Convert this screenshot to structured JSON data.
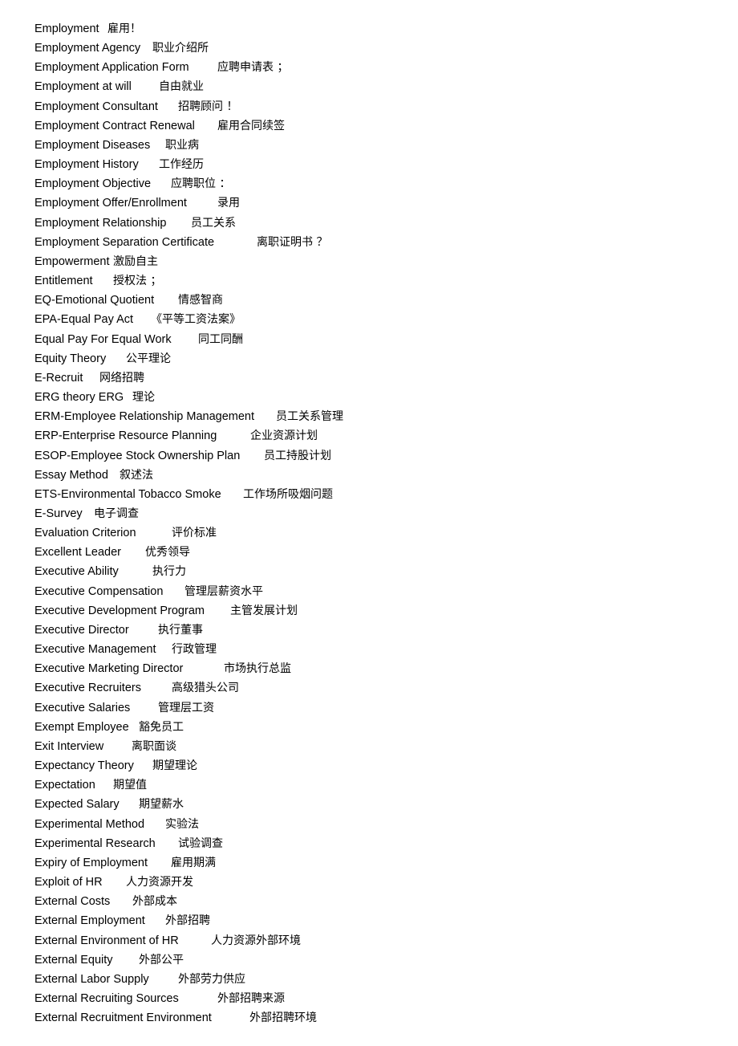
{
  "glossary": {
    "entries": [
      {
        "term": "Employment",
        "translation": "雇用！"
      },
      {
        "term": "Employment Agency",
        "translation": "职业介绍所"
      },
      {
        "term": "Employment Application Form",
        "translation": "应聘申请表 ；"
      },
      {
        "term": "Employment at will",
        "translation": "自由就业"
      },
      {
        "term": "Employment Consultant",
        "translation": "招聘顾问 ！"
      },
      {
        "term": "Employment Contract Renewal",
        "translation": "雇用合同续签"
      },
      {
        "term": "Employment Diseases",
        "translation": "职业病"
      },
      {
        "term": "Employment History",
        "translation": "工作经历"
      },
      {
        "term": "Employment Objective",
        "translation": "应聘职位 ："
      },
      {
        "term": "Employment Offer/Enrollment",
        "translation": "录用"
      },
      {
        "term": "Employment Relationship",
        "translation": "员工关系"
      },
      {
        "term": "Employment Separation Certificate",
        "translation": "离职证明书 ？"
      },
      {
        "term": "Empowerment",
        "translation": "激励自主"
      },
      {
        "term": "Entitlement",
        "translation": "授权法 ；"
      },
      {
        "term": "EQ-Emotional Quotient",
        "translation": "情感智商"
      },
      {
        "term": "EPA-Equal Pay Act",
        "translation": "《平等工资法案》"
      },
      {
        "term": "Equal Pay For Equal Work",
        "translation": "同工同酬"
      },
      {
        "term": "Equity Theory",
        "translation": "公平理论"
      },
      {
        "term": "E-Recruit",
        "translation": "网络招聘"
      },
      {
        "term": "ERG theory ERG",
        "translation": "理论"
      },
      {
        "term": "ERM-Employee Relationship Management",
        "translation": "员工关系管理"
      },
      {
        "term": "ERP-Enterprise Resource Planning",
        "translation": "企业资源计划"
      },
      {
        "term": "ESOP-Employee Stock Ownership Plan",
        "translation": "员工持股计划"
      },
      {
        "term": "Essay Method",
        "translation": "叙述法"
      },
      {
        "term": "ETS-Environmental Tobacco Smoke",
        "translation": "工作场所吸烟问题"
      },
      {
        "term": "E-Survey",
        "translation": "电子调查"
      },
      {
        "term": "Evaluation Criterion",
        "translation": "评价标准"
      },
      {
        "term": "Excellent Leader",
        "translation": "优秀领导"
      },
      {
        "term": "Executive Ability",
        "translation": "执行力"
      },
      {
        "term": "Executive Compensation",
        "translation": "管理层薪资水平"
      },
      {
        "term": "Executive Development Program",
        "translation": "主管发展计划"
      },
      {
        "term": "Executive Director",
        "translation": "执行董事"
      },
      {
        "term": "Executive Management",
        "translation": "行政管理"
      },
      {
        "term": "Executive Marketing Director",
        "translation": "市场执行总监"
      },
      {
        "term": "Executive Recruiters",
        "translation": "高级猎头公司"
      },
      {
        "term": "Executive Salaries",
        "translation": "管理层工资"
      },
      {
        "term": "Exempt Employee",
        "translation": "豁免员工"
      },
      {
        "term": "Exit Interview",
        "translation": "离职面谈"
      },
      {
        "term": "Expectancy Theory",
        "translation": "期望理论"
      },
      {
        "term": "Expectation",
        "translation": "期望值"
      },
      {
        "term": "Expected Salary",
        "translation": "期望薪水"
      },
      {
        "term": "Experimental Method",
        "translation": "实验法"
      },
      {
        "term": "Experimental Research",
        "translation": "试验调查"
      },
      {
        "term": "Expiry of Employment",
        "translation": "雇用期满"
      },
      {
        "term": "Exploit of HR",
        "translation": "人力资源开发"
      },
      {
        "term": "External Costs",
        "translation": "外部成本"
      },
      {
        "term": "External Employment",
        "translation": "外部招聘"
      },
      {
        "term": "External Environment of HR",
        "translation": "人力资源外部环境"
      },
      {
        "term": "External Equity",
        "translation": "外部公平"
      },
      {
        "term": "External Labor Supply",
        "translation": "外部劳力供应"
      },
      {
        "term": "External Recruiting Sources",
        "translation": "外部招聘来源"
      },
      {
        "term": "External Recruitment Environment",
        "translation": "外部招聘环境"
      }
    ]
  }
}
